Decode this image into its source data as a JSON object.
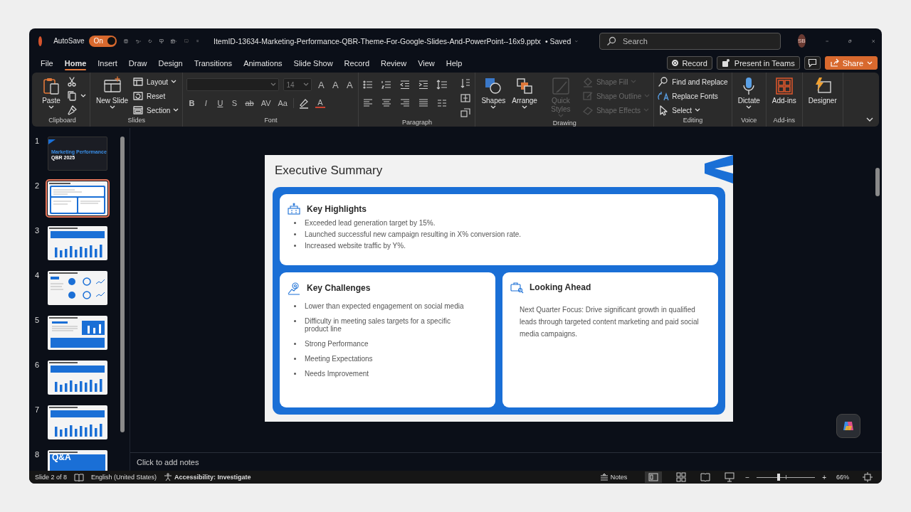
{
  "title_bar": {
    "autosave_label": "AutoSave",
    "autosave": {
      "label": "On",
      "on": true
    },
    "file_name": "ItemID-13634-Marketing-Performance-QBR-Theme-For-Google-Slides-And-PowerPoint--16x9.pptx",
    "save_status": "• Saved",
    "search": {
      "placeholder": "Search"
    },
    "user_initials": "SB"
  },
  "menu_tabs": [
    {
      "label": "File",
      "selected": false
    },
    {
      "label": "Home",
      "selected": true
    },
    {
      "label": "Insert",
      "selected": false
    },
    {
      "label": "Draw",
      "selected": false
    },
    {
      "label": "Design",
      "selected": false
    },
    {
      "label": "Transitions",
      "selected": false
    },
    {
      "label": "Animations",
      "selected": false
    },
    {
      "label": "Slide Show",
      "selected": false
    },
    {
      "label": "Record",
      "selected": false
    },
    {
      "label": "Review",
      "selected": false
    },
    {
      "label": "View",
      "selected": false
    },
    {
      "label": "Help",
      "selected": false
    }
  ],
  "actions": [
    {
      "kind": "record",
      "label": "Record"
    },
    {
      "kind": "teams",
      "label": "Present in Teams"
    },
    {
      "kind": "comments"
    },
    {
      "kind": "share",
      "label": "Share"
    }
  ],
  "ribbon": {
    "groups": [
      {
        "kind": "clipboard",
        "label": "Clipboard",
        "items": [
          {
            "kind": "large",
            "label": "Paste",
            "dropdown": true,
            "disabled": false
          },
          {
            "kind": "small",
            "dropdown": false,
            "disabled": false
          },
          {
            "kind": "small",
            "dropdown": true,
            "disabled": false
          },
          {
            "kind": "small",
            "dropdown": false,
            "disabled": false
          }
        ]
      },
      {
        "kind": "slides",
        "label": "Slides",
        "items": [
          {
            "kind": "large",
            "label": "New Slide",
            "dropdown": true,
            "disabled": false
          },
          {
            "kind": "small",
            "label": "Layout",
            "dropdown": true,
            "disabled": false
          },
          {
            "kind": "small",
            "label": "Reset",
            "dropdown": false,
            "disabled": false
          },
          {
            "kind": "small",
            "label": "Section",
            "dropdown": true,
            "disabled": false
          }
        ]
      },
      {
        "kind": "font",
        "label": "Font",
        "font_size": "14",
        "grow_buttons": [
          "A",
          "A",
          "A"
        ],
        "format_buttons": [
          "B",
          "I",
          "U",
          "S",
          "ab",
          "AV",
          "Aa"
        ],
        "color_button": "A"
      },
      {
        "kind": "paragraph",
        "label": "Paragraph"
      },
      {
        "kind": "drawing",
        "label": "Drawing",
        "items": [
          {
            "kind": "large",
            "label": "Shapes",
            "dropdown": true,
            "disabled": false
          },
          {
            "kind": "large",
            "label": "Arrange",
            "dropdown": true,
            "disabled": false
          },
          {
            "kind": "large",
            "label": "Quick Styles",
            "dropdown": true,
            "disabled": true
          },
          {
            "kind": "small",
            "label": "Shape Fill",
            "dropdown": true,
            "disabled": true
          },
          {
            "kind": "small",
            "label": "Shape Outline",
            "dropdown": true,
            "disabled": true
          },
          {
            "kind": "small",
            "label": "Shape Effects",
            "dropdown": true,
            "disabled": true
          }
        ]
      },
      {
        "kind": "editing",
        "label": "Editing",
        "items": [
          {
            "kind": "small",
            "label": "Find and Replace",
            "dropdown": false,
            "disabled": false
          },
          {
            "kind": "small",
            "label": "Replace Fonts",
            "dropdown": false,
            "disabled": false
          },
          {
            "kind": "small",
            "label": "Select",
            "dropdown": true,
            "disabled": false
          }
        ]
      },
      {
        "kind": "voice",
        "label": "Voice",
        "items": [
          {
            "kind": "large",
            "label": "Dictate",
            "dropdown": true,
            "disabled": false
          }
        ]
      },
      {
        "kind": "addins",
        "label": "Add-ins",
        "items": [
          {
            "kind": "large",
            "label": "Add-ins",
            "dropdown": false,
            "disabled": false
          }
        ]
      },
      {
        "kind": "designer",
        "items": [
          {
            "kind": "large",
            "label": "Designer",
            "dropdown": false,
            "disabled": false
          }
        ]
      }
    ]
  },
  "slides": [
    {
      "number": "1",
      "kind": "title",
      "selected": false,
      "title": "Marketing Performance",
      "subtitle": "QBR 2025"
    },
    {
      "number": "2",
      "kind": "summary",
      "selected": true
    },
    {
      "number": "3",
      "kind": "bars",
      "selected": false
    },
    {
      "number": "4",
      "kind": "stats",
      "selected": false
    },
    {
      "number": "5",
      "kind": "panel",
      "selected": false
    },
    {
      "number": "6",
      "kind": "bars",
      "selected": false
    },
    {
      "number": "7",
      "kind": "bars",
      "selected": false
    },
    {
      "number": "8",
      "kind": "qa",
      "selected": false,
      "title": "Q&A"
    }
  ],
  "slide": {
    "title": "Executive Summary",
    "highlights": {
      "title": "Key Highlights",
      "bullets": [
        "Exceeded lead generation target by 15%.",
        "Launched successful new campaign resulting in X% conversion rate.",
        "Increased website traffic by Y%."
      ]
    },
    "challenges": {
      "title": "Key Challenges",
      "bullets": [
        "Lower than expected engagement on social media",
        "Difficulty in meeting sales targets for a specific product line",
        "Strong Performance",
        "Meeting Expectations",
        "Needs Improvement"
      ]
    },
    "outlook": {
      "title": "Looking Ahead",
      "text": "Next Quarter Focus: Drive significant growth in qualified leads through targeted content marketing and paid social media campaigns."
    }
  },
  "notes": {
    "placeholder": "Click to add notes"
  },
  "status_bar": {
    "slide_position": "Slide 2 of 8",
    "language": "English (United States)",
    "accessibility": "Accessibility: Investigate",
    "notes": "Notes",
    "zoom_out": "−",
    "zoom_in": "+",
    "zoom": {
      "level": 0.38
    },
    "zoom_percent": "66%"
  }
}
